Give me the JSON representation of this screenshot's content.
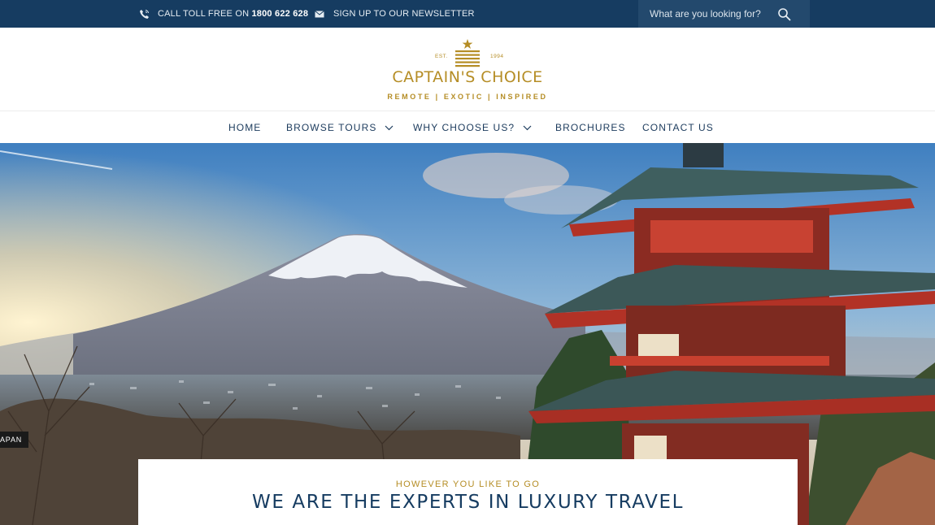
{
  "topbar": {
    "phone_prefix": "CALL TOLL FREE ON",
    "phone_number": "1800 622 628",
    "newsletter_label": "SIGN UP TO OUR NEWSLETTER",
    "search_placeholder": "What are you looking for?",
    "icons": {
      "phone": "phone-icon",
      "newsletter": "envelope-icon",
      "search": "search-icon"
    }
  },
  "brand": {
    "est_label": "EST.",
    "est_year": "1994",
    "name": "CAPTAIN'S CHOICE",
    "tagline": "REMOTE | EXOTIC | INSPIRED",
    "color": "#b58d25"
  },
  "nav": {
    "items": [
      {
        "label": "HOME",
        "has_dropdown": false
      },
      {
        "label": "BROWSE TOURS",
        "has_dropdown": true
      },
      {
        "label": "WHY CHOOSE US?",
        "has_dropdown": true
      },
      {
        "label": "BROCHURES",
        "has_dropdown": false
      },
      {
        "label": "CONTACT US",
        "has_dropdown": false
      }
    ]
  },
  "hero": {
    "location_label": "APAN"
  },
  "intro": {
    "eyebrow": "HOWEVER YOU LIKE TO GO",
    "title": "WE ARE THE EXPERTS IN LUXURY TRAVEL"
  },
  "colors": {
    "navy": "#163c61",
    "gold": "#b58d25",
    "search_bg": "#23496d"
  }
}
